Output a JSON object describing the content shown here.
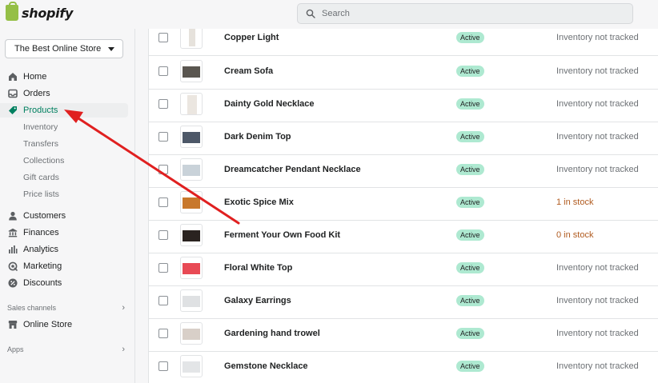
{
  "brand": {
    "name": "shopify",
    "color": "#95bf47"
  },
  "search": {
    "placeholder": "Search",
    "icon": "search-icon"
  },
  "store_selector": {
    "value": "The Best Online Store"
  },
  "nav": {
    "items": [
      {
        "label": "Home",
        "icon": "home-icon"
      },
      {
        "label": "Orders",
        "icon": "orders-icon"
      },
      {
        "label": "Products",
        "icon": "tag-icon",
        "active": true
      }
    ],
    "product_sub": [
      "Inventory",
      "Transfers",
      "Collections",
      "Gift cards",
      "Price lists"
    ],
    "items2": [
      {
        "label": "Customers",
        "icon": "person-icon"
      },
      {
        "label": "Finances",
        "icon": "bank-icon"
      },
      {
        "label": "Analytics",
        "icon": "bar-chart-icon"
      },
      {
        "label": "Marketing",
        "icon": "megaphone-icon"
      },
      {
        "label": "Discounts",
        "icon": "discount-icon"
      }
    ],
    "sales_channels": "Sales channels",
    "online_store": {
      "label": "Online Store",
      "icon": "store-icon"
    },
    "apps": "Apps"
  },
  "products": [
    {
      "name": "Copper Light",
      "status": "Active",
      "inventory": "Inventory not tracked"
    },
    {
      "name": "Cream Sofa",
      "status": "Active",
      "inventory": "Inventory not tracked"
    },
    {
      "name": "Dainty Gold Necklace",
      "status": "Active",
      "inventory": "Inventory not tracked"
    },
    {
      "name": "Dark Denim Top",
      "status": "Active",
      "inventory": "Inventory not tracked"
    },
    {
      "name": "Dreamcatcher Pendant Necklace",
      "status": "Active",
      "inventory": "Inventory not tracked"
    },
    {
      "name": "Exotic Spice Mix",
      "status": "Active",
      "inventory": "1 in stock"
    },
    {
      "name": "Ferment Your Own Food Kit",
      "status": "Active",
      "inventory": "0 in stock"
    },
    {
      "name": "Floral White Top",
      "status": "Active",
      "inventory": "Inventory not tracked"
    },
    {
      "name": "Galaxy Earrings",
      "status": "Active",
      "inventory": "Inventory not tracked"
    },
    {
      "name": "Gardening hand trowel",
      "status": "Active",
      "inventory": "Inventory not tracked"
    },
    {
      "name": "Gemstone Necklace",
      "status": "Active",
      "inventory": "Inventory not tracked"
    }
  ],
  "colors": {
    "accent": "#008060",
    "badge": "#aee9d1",
    "arrow": "#e02020",
    "stock": "#b05a1e"
  }
}
